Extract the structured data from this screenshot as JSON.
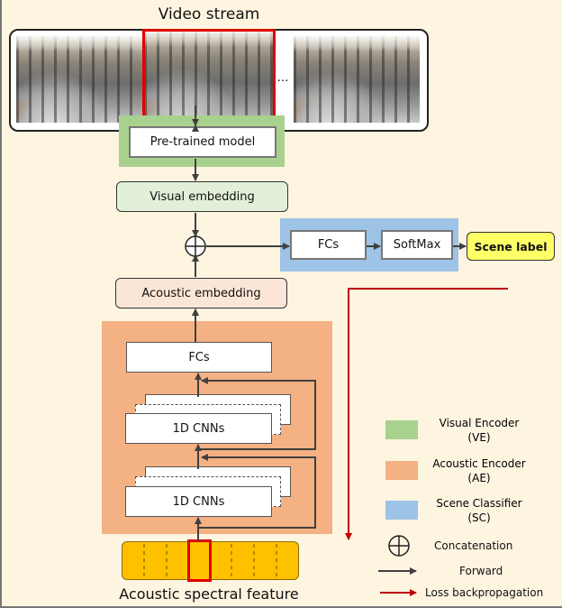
{
  "title": "Video stream",
  "video": {
    "ellipsis": "…",
    "frames": 3,
    "selected_frame": 2
  },
  "visual_encoder": {
    "pretrained_label": "Pre-trained model"
  },
  "visual_embedding": "Visual embedding",
  "acoustic_embedding": "Acoustic embedding",
  "scene_classifier": {
    "fcs_label": "FCs",
    "softmax_label": "SoftMax"
  },
  "scene_label": "Scene label",
  "acoustic_encoder": {
    "fcs_label": "FCs",
    "cnn_labels": [
      "1D CNNs",
      "1D CNNs"
    ]
  },
  "spectral_feature_label": "Acoustic spectral feature",
  "legend": {
    "items": [
      {
        "label": "Visual Encoder",
        "sub": "(VE)",
        "color": "#a9d18e"
      },
      {
        "label": "Acoustic Encoder",
        "sub": "(AE)",
        "color": "#f4b183"
      },
      {
        "label": "Scene Classifier",
        "sub": "(SC)",
        "color": "#9dc3e6"
      }
    ],
    "concat_label": "Concatenation",
    "forward_label": "Forward",
    "backprop_label": "Loss backpropagation"
  },
  "colors": {
    "background": "#fef5e1",
    "ve": "#a9d18e",
    "ae": "#f4b183",
    "sc": "#9dc3e6",
    "visual_embedding": "#e2f0d9",
    "acoustic_embedding": "#fbe5d6",
    "scene_label": "#ffff66",
    "spectral": "#ffc000",
    "highlight": "#e00000",
    "backprop": "#c00000",
    "arrow": "#404040"
  }
}
